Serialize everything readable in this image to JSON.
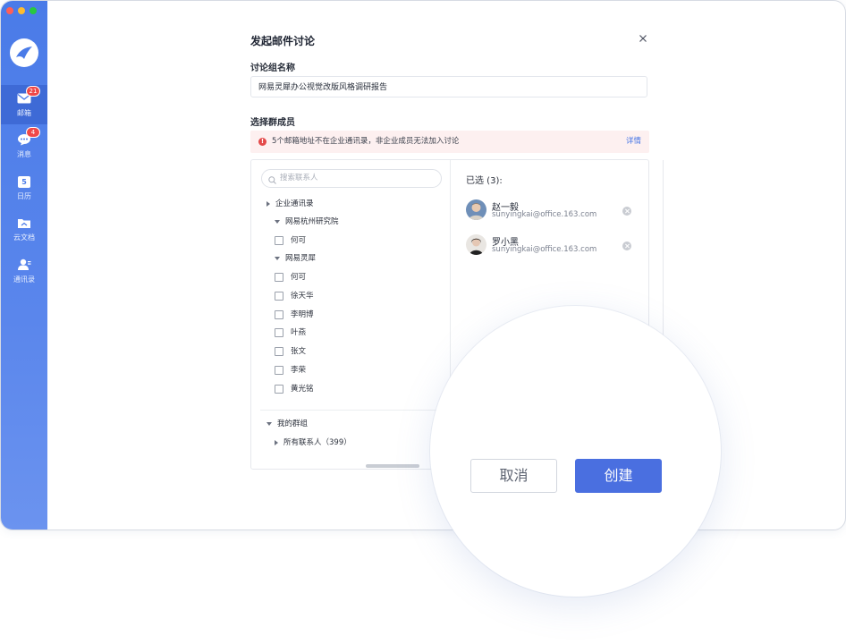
{
  "sidebar": {
    "items": [
      {
        "label": "邮箱",
        "icon": "mail-icon",
        "badge": "21"
      },
      {
        "label": "消息",
        "icon": "chat-icon",
        "badge": "4"
      },
      {
        "label": "日历",
        "icon": "calendar-icon",
        "badge": "",
        "icon_text": "5"
      },
      {
        "label": "云文档",
        "icon": "cloud-folder-icon",
        "badge": ""
      },
      {
        "label": "通讯录",
        "icon": "contacts-icon",
        "badge": ""
      }
    ]
  },
  "dialog": {
    "title": "发起邮件讨论",
    "group_name_label": "讨论组名称",
    "group_name_value": "网易灵犀办公视觉改版风格调研报告",
    "members_label": "选择群成员",
    "alert": {
      "message": "5个邮箱地址不在企业通讯录，非企业成员无法加入讨论",
      "detail": "详情"
    },
    "search_placeholder": "搜索联系人",
    "tree": {
      "enterprise": "企业通讯录",
      "dept1": "网易杭州研究院",
      "dept1_members": [
        "何可"
      ],
      "dept2": "网易灵犀",
      "dept2_members": [
        "何可",
        "徐天华",
        "李明博",
        "叶燕",
        "张文",
        "李荣",
        "黄光铭"
      ],
      "my_groups": "我的群组",
      "all_contacts": "所有联系人（399）"
    },
    "selected": {
      "title": "已选 (3):",
      "members": [
        {
          "name": "赵一毅",
          "email": "sunyingkai@office.163.com"
        },
        {
          "name": "罗小黑",
          "email": "sunyingkai@office.163.com"
        }
      ]
    },
    "buttons": {
      "cancel": "取消",
      "create": "创建"
    }
  },
  "colors": {
    "accent": "#4a6fe0",
    "sidebar": "#4a7be8",
    "alert_bg": "#fdf0f0",
    "alert_icon": "#e34a4a"
  }
}
